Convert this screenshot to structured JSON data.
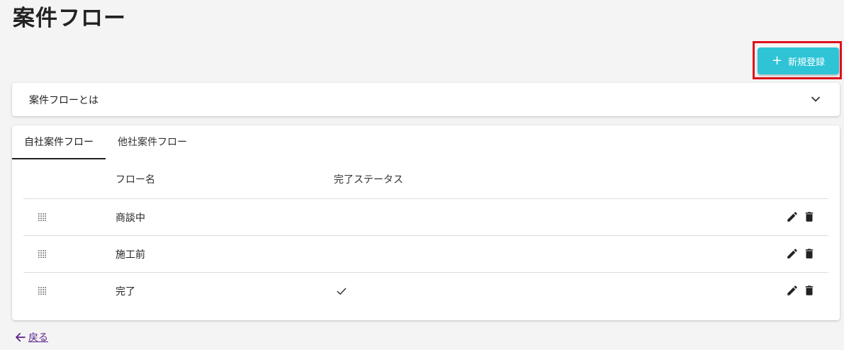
{
  "page": {
    "title": "案件フロー"
  },
  "toolbar": {
    "new_plus": "+",
    "new_label": "新規登録"
  },
  "accordion": {
    "title": "案件フローとは"
  },
  "tabs": [
    {
      "label": "自社案件フロー",
      "active": true
    },
    {
      "label": "他社案件フロー",
      "active": false
    }
  ],
  "table": {
    "headers": {
      "name": "フロー名",
      "status": "完了ステータス"
    },
    "rows": [
      {
        "name": "商談中",
        "completed": false
      },
      {
        "name": "施工前",
        "completed": false
      },
      {
        "name": "完了",
        "completed": true
      }
    ]
  },
  "footer": {
    "back_label": "戻る"
  },
  "colors": {
    "accent": "#2ec4d6",
    "highlight": "#e0101a",
    "link": "#5b1f8a",
    "background": "#f4f4f4"
  },
  "icons": {
    "expand": "chevron-down-icon",
    "drag": "drag-handle-icon",
    "check": "check-icon",
    "edit": "pencil-icon",
    "delete": "trash-icon",
    "back": "arrow-left-icon"
  }
}
